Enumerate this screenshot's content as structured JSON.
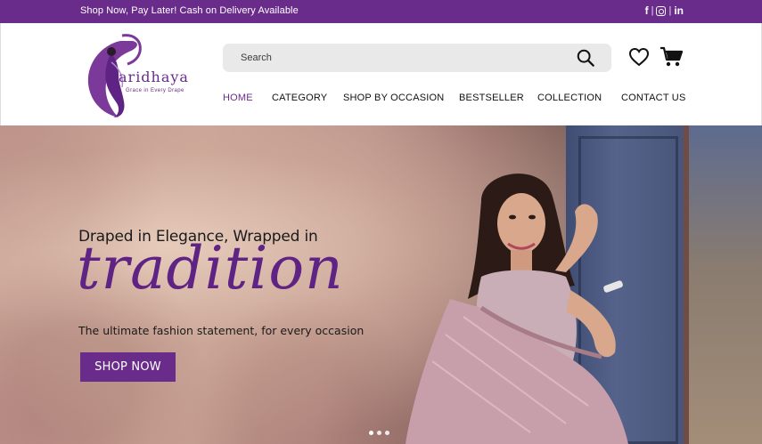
{
  "announcement": {
    "text": "Shop Now, Pay Later! Cash on Delivery Available",
    "social": [
      {
        "icon": "facebook-icon",
        "glyph": "f"
      },
      {
        "icon": "instagram-icon",
        "glyph": ""
      },
      {
        "icon": "linkedin-icon",
        "glyph": "in"
      }
    ],
    "separator": "|"
  },
  "brand": {
    "name": "aridhaya",
    "tagline": "Grace in Every Drape"
  },
  "search": {
    "placeholder": "Search",
    "value": ""
  },
  "nav": {
    "items": [
      {
        "label": "HOME",
        "active": true
      },
      {
        "label": "CATEGORY",
        "active": false
      },
      {
        "label": "SHOP BY OCCASION",
        "active": false
      },
      {
        "label": "BESTSELLER",
        "active": false
      },
      {
        "label": "COLLECTION",
        "active": false
      },
      {
        "label": "CONTACT US",
        "active": false
      }
    ]
  },
  "hero": {
    "tagline": "Draped in Elegance, Wrapped in",
    "headline": "tradition",
    "subline": "The ultimate fashion statement, for every occasion",
    "cta": "SHOP NOW",
    "slides": 3
  },
  "colors": {
    "brand_purple": "#6a2c8a",
    "headline_purple": "#5f2384"
  }
}
